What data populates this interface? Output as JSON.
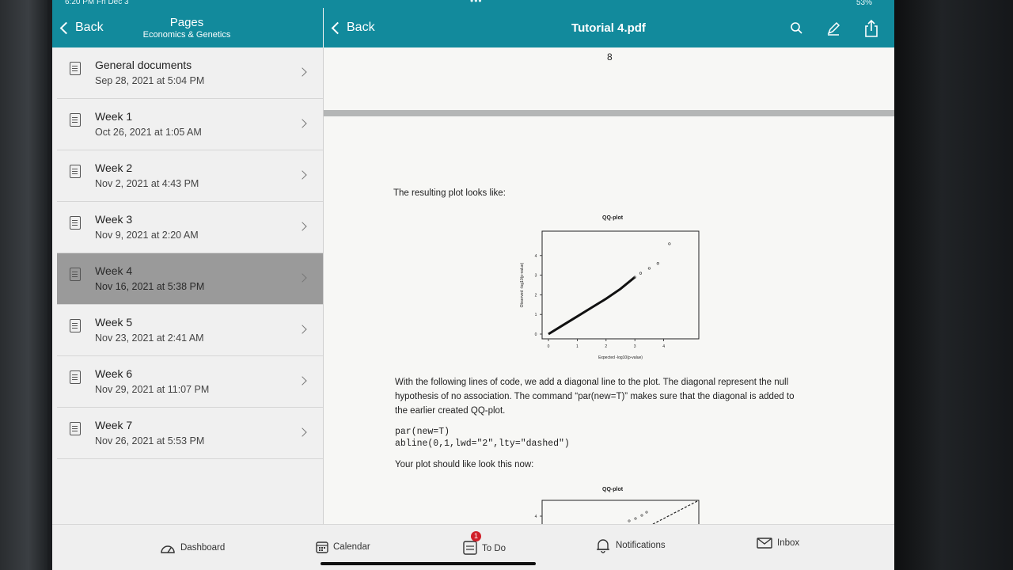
{
  "status": {
    "time": "6:20 PM  Fri Dec 3",
    "battery": "53%",
    "dots": "•••"
  },
  "left_nav": {
    "back": "Back",
    "title": "Pages",
    "subtitle": "Economics & Genetics"
  },
  "right_nav": {
    "back": "Back",
    "title": "Tutorial 4.pdf",
    "icons": [
      "search-icon",
      "pen-icon",
      "share-icon"
    ]
  },
  "pages": [
    {
      "title": "General documents",
      "date": "Sep 28, 2021 at 5:04 PM"
    },
    {
      "title": "Week 1",
      "date": "Oct 26, 2021 at 1:05 AM"
    },
    {
      "title": "Week 2",
      "date": "Nov 2, 2021 at 4:43 PM"
    },
    {
      "title": "Week 3",
      "date": "Nov 9, 2021 at 2:20 AM"
    },
    {
      "title": "Week 4",
      "date": "Nov 16, 2021 at 5:38 PM"
    },
    {
      "title": "Week 5",
      "date": "Nov 23, 2021 at 2:41 AM"
    },
    {
      "title": "Week 6",
      "date": "Nov 29, 2021 at 11:07 PM"
    },
    {
      "title": "Week 7",
      "date": "Nov 26, 2021 at 5:53 PM"
    }
  ],
  "selected_index": 4,
  "pdf": {
    "page_number": "8",
    "intro": "The resulting plot looks like:",
    "paragraph_lines": [
      "With the following lines of code, we add a diagonal line to the plot. The diagonal represent the null",
      "hypothesis of no association. The command “par(new=T)” makes sure that the diagonal is added to",
      "the earlier created QQ-plot."
    ],
    "code_lines": [
      "par(new=T)",
      "abline(0,1,lwd=\"2\",lty=\"dashed\")"
    ],
    "outro": "Your plot should like look this now:"
  },
  "chart_data": [
    {
      "type": "scatter",
      "title": "QQ-plot",
      "xlabel": "Expected -log10(p-value)",
      "ylabel": "Observed -log10(p-value)",
      "xlim": [
        0,
        5
      ],
      "ylim": [
        0,
        5
      ],
      "x_ticks": [
        "0",
        "1",
        "2",
        "3",
        "4"
      ],
      "y_ticks": [
        "0",
        "1",
        "2",
        "3",
        "4"
      ],
      "series": [
        {
          "x": [
            0,
            0.5,
            1,
            1.5,
            2,
            2.5,
            3,
            3.2,
            3.5,
            3.8,
            4.2
          ],
          "y": [
            0,
            0.45,
            0.9,
            1.35,
            1.8,
            2.3,
            2.9,
            3.1,
            3.35,
            3.6,
            4.6
          ]
        }
      ]
    },
    {
      "type": "scatter",
      "title": "QQ-plot",
      "xlim": [
        0,
        5
      ],
      "ylim": [
        0,
        5
      ],
      "y_ticks": [
        "4"
      ]
    }
  ],
  "tabs": [
    {
      "label": "Dashboard",
      "icon": "dashboard-icon"
    },
    {
      "label": "Calendar",
      "icon": "calendar-icon"
    },
    {
      "label": "To Do",
      "icon": "todo-icon",
      "badge": "1"
    },
    {
      "label": "Notifications",
      "icon": "bell-icon"
    },
    {
      "label": "Inbox",
      "icon": "inbox-icon"
    }
  ]
}
